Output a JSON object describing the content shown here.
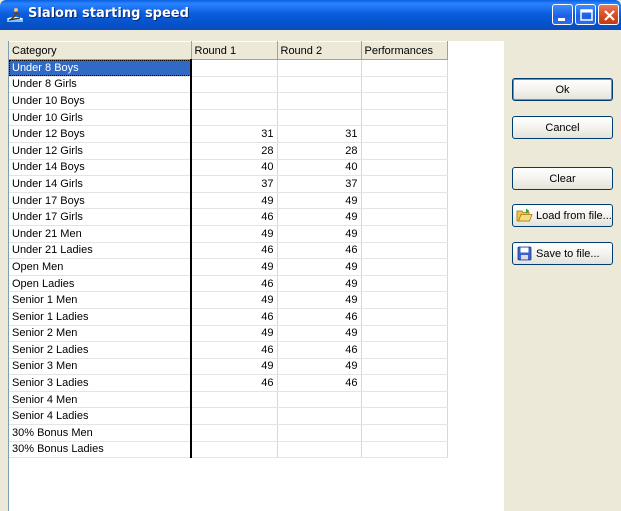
{
  "window": {
    "title": "Slalom starting speed"
  },
  "grid": {
    "columns": [
      "Category",
      "Round 1",
      "Round 2",
      "Performances"
    ],
    "rows": [
      {
        "category": "Under 8 Boys",
        "round1": "",
        "round2": "",
        "performances": ""
      },
      {
        "category": "Under 8 Girls",
        "round1": "",
        "round2": "",
        "performances": ""
      },
      {
        "category": "Under 10 Boys",
        "round1": "",
        "round2": "",
        "performances": ""
      },
      {
        "category": "Under 10 Girls",
        "round1": "",
        "round2": "",
        "performances": ""
      },
      {
        "category": "Under 12 Boys",
        "round1": "31",
        "round2": "31",
        "performances": ""
      },
      {
        "category": "Under 12 Girls",
        "round1": "28",
        "round2": "28",
        "performances": ""
      },
      {
        "category": "Under 14 Boys",
        "round1": "40",
        "round2": "40",
        "performances": ""
      },
      {
        "category": "Under 14 Girls",
        "round1": "37",
        "round2": "37",
        "performances": ""
      },
      {
        "category": "Under 17 Boys",
        "round1": "49",
        "round2": "49",
        "performances": ""
      },
      {
        "category": "Under 17 Girls",
        "round1": "46",
        "round2": "49",
        "performances": ""
      },
      {
        "category": "Under 21 Men",
        "round1": "49",
        "round2": "49",
        "performances": ""
      },
      {
        "category": "Under 21 Ladies",
        "round1": "46",
        "round2": "46",
        "performances": ""
      },
      {
        "category": "Open Men",
        "round1": "49",
        "round2": "49",
        "performances": ""
      },
      {
        "category": "Open Ladies",
        "round1": "46",
        "round2": "49",
        "performances": ""
      },
      {
        "category": "Senior 1 Men",
        "round1": "49",
        "round2": "49",
        "performances": ""
      },
      {
        "category": "Senior 1 Ladies",
        "round1": "46",
        "round2": "46",
        "performances": ""
      },
      {
        "category": "Senior 2 Men",
        "round1": "49",
        "round2": "49",
        "performances": ""
      },
      {
        "category": "Senior 2 Ladies",
        "round1": "46",
        "round2": "46",
        "performances": ""
      },
      {
        "category": "Senior 3 Men",
        "round1": "49",
        "round2": "49",
        "performances": ""
      },
      {
        "category": "Senior 3 Ladies",
        "round1": "46",
        "round2": "46",
        "performances": ""
      },
      {
        "category": "Senior 4 Men",
        "round1": "",
        "round2": "",
        "performances": ""
      },
      {
        "category": "Senior 4 Ladies",
        "round1": "",
        "round2": "",
        "performances": ""
      },
      {
        "category": "30% Bonus Men",
        "round1": "",
        "round2": "",
        "performances": ""
      },
      {
        "category": "30% Bonus Ladies",
        "round1": "",
        "round2": "",
        "performances": ""
      }
    ],
    "selected_index": 0
  },
  "buttons": {
    "ok": "Ok",
    "cancel": "Cancel",
    "clear": "Clear",
    "load": "Load from file...",
    "save": "Save to file..."
  },
  "icons": {
    "app": "waterski-icon",
    "load": "folder-open-icon",
    "save": "floppy-disk-icon"
  },
  "colors": {
    "titlebar": "#0B5EDD",
    "selection": "#316AC5",
    "dialog_bg": "#ECE9D8"
  }
}
